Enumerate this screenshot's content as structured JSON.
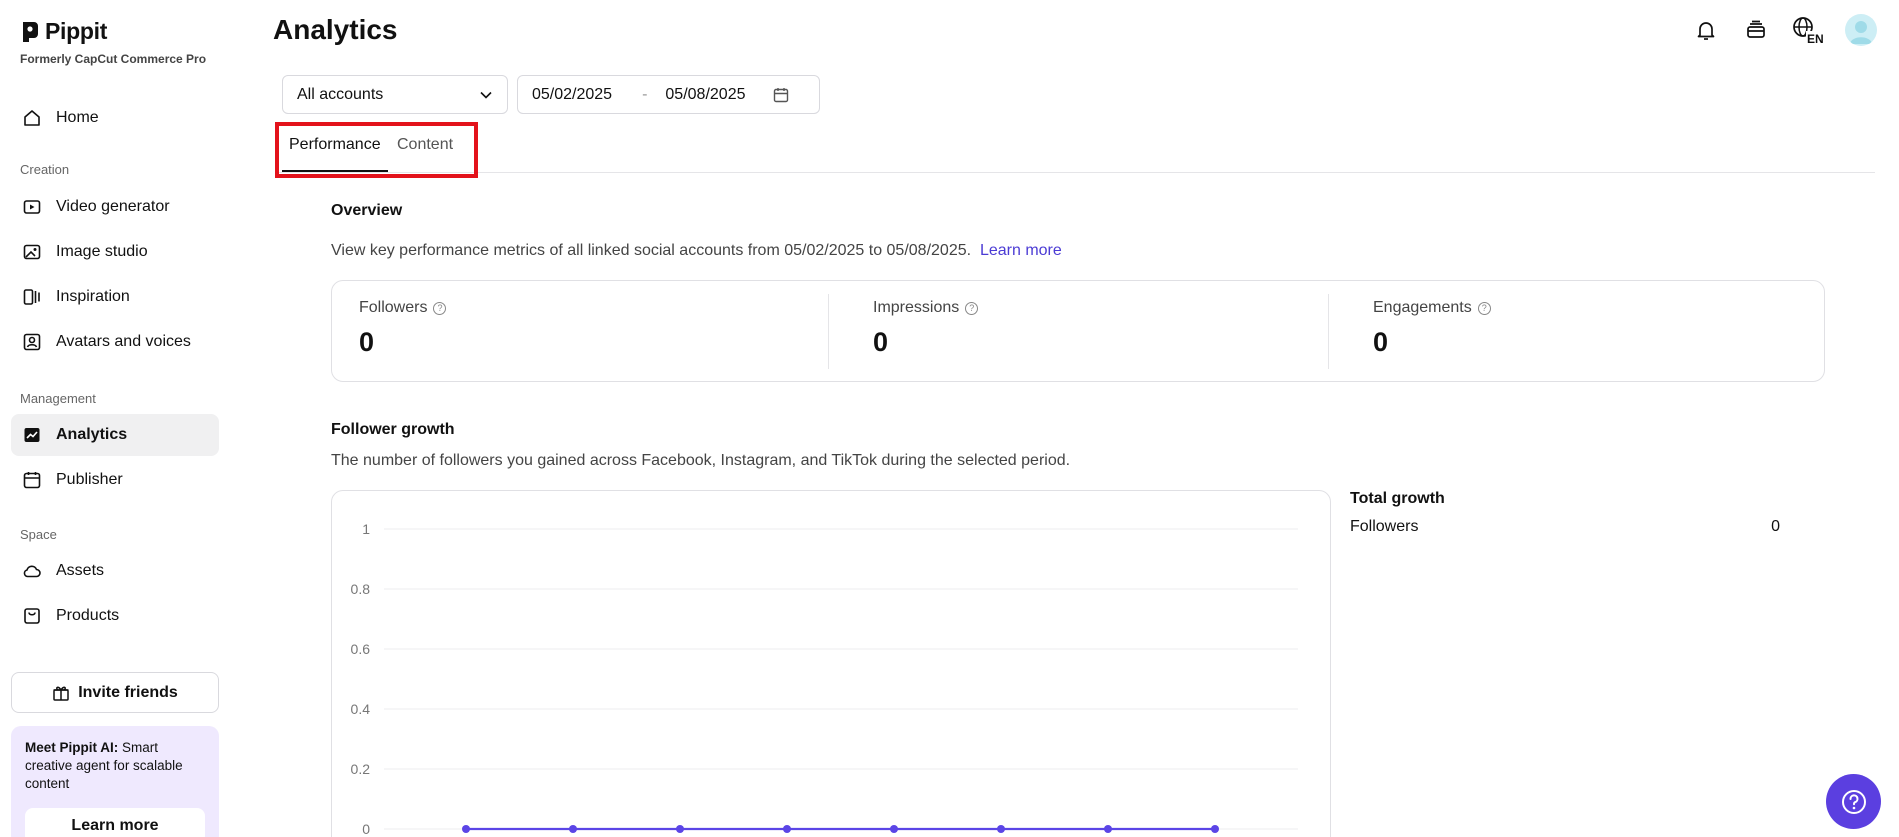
{
  "brand": {
    "name": "Pippit",
    "subtitle": "Formerly CapCut Commerce Pro"
  },
  "sidebar": {
    "home": "Home",
    "sections": {
      "creation": "Creation",
      "management": "Management",
      "space": "Space"
    },
    "creation_items": [
      "Video generator",
      "Image studio",
      "Inspiration",
      "Avatars and voices"
    ],
    "management_items": [
      "Analytics",
      "Publisher"
    ],
    "space_items": [
      "Assets",
      "Products"
    ],
    "active": "Analytics",
    "invite": "Invite friends",
    "promo": {
      "bold": "Meet Pippit AI:",
      "text": " Smart creative agent for scalable content",
      "button": "Learn more"
    }
  },
  "header": {
    "title": "Analytics",
    "language": "EN"
  },
  "filters": {
    "account": "All accounts",
    "date_start": "05/02/2025",
    "date_separator": "-",
    "date_end": "05/08/2025"
  },
  "tabs": [
    {
      "label": "Performance",
      "active": true
    },
    {
      "label": "Content",
      "active": false
    }
  ],
  "overview": {
    "title": "Overview",
    "description": "View key performance metrics of all linked social accounts from 05/02/2025 to 05/08/2025.",
    "link": "Learn more",
    "metrics": [
      {
        "label": "Followers",
        "value": "0"
      },
      {
        "label": "Impressions",
        "value": "0"
      },
      {
        "label": "Engagements",
        "value": "0"
      }
    ]
  },
  "follower_growth": {
    "title": "Follower growth",
    "description": "The number of followers you gained across Facebook, Instagram, and TikTok during the selected period.",
    "total": {
      "title": "Total growth",
      "label": "Followers",
      "value": "0"
    }
  },
  "chart_data": {
    "type": "line",
    "title": "",
    "xlabel": "",
    "ylabel": "",
    "ylim": [
      0,
      1
    ],
    "yticks": [
      "0",
      "0.2",
      "0.4",
      "0.6",
      "0.8",
      "1"
    ],
    "x": [
      1,
      2,
      3,
      4,
      5,
      6,
      7,
      8
    ],
    "series": [
      {
        "values": [
          0,
          0,
          0,
          0,
          0,
          0,
          0,
          0
        ]
      }
    ],
    "grid": true,
    "color": "#5b45e6"
  },
  "colors": {
    "accent": "#5b3fe0",
    "link": "#4b3bd4",
    "highlight": "#e3121b"
  }
}
